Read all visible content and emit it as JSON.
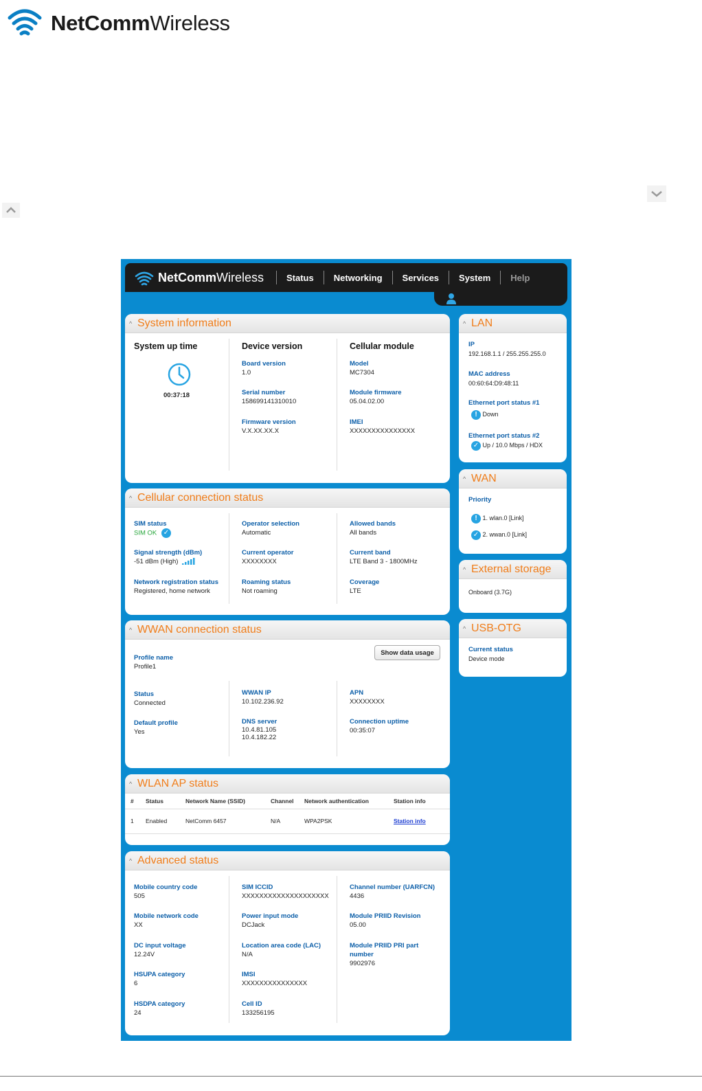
{
  "doc_logo": {
    "brand_bold": "NetComm",
    "brand_light": "Wireless"
  },
  "app": {
    "brand_bold": "NetComm",
    "brand_light": "Wireless",
    "nav": [
      "Status",
      "Networking",
      "Services",
      "System",
      "Help"
    ]
  },
  "system_info": {
    "title": "System information",
    "uptime_label": "System up time",
    "uptime": "00:37:18",
    "device_version": {
      "heading": "Device version",
      "fields": [
        {
          "label": "Board version",
          "value": "1.0"
        },
        {
          "label": "Serial number",
          "value": "158699141310010"
        },
        {
          "label": "Firmware version",
          "value": "V.X.XX.XX.X"
        }
      ]
    },
    "cellular_module": {
      "heading": "Cellular module",
      "fields": [
        {
          "label": "Model",
          "value": "MC7304"
        },
        {
          "label": "Module firmware",
          "value": "05.04.02.00"
        },
        {
          "label": "IMEI",
          "value": "XXXXXXXXXXXXXXX"
        }
      ]
    }
  },
  "cellular": {
    "title": "Cellular connection status",
    "sim_status_label": "SIM status",
    "sim_status": "SIM OK",
    "signal_label": "Signal strength (dBm)",
    "signal": "-51 dBm (High)",
    "netreg_label": "Network registration status",
    "netreg": "Registered, home network",
    "operator_selection_label": "Operator selection",
    "operator_selection": "Automatic",
    "current_operator_label": "Current operator",
    "current_operator": "XXXXXXXX",
    "roaming_label": "Roaming status",
    "roaming": "Not roaming",
    "allowed_bands_label": "Allowed bands",
    "allowed_bands": "All bands",
    "current_band_label": "Current band",
    "current_band": "LTE Band 3 - 1800MHz",
    "coverage_label": "Coverage",
    "coverage": "LTE"
  },
  "wwan": {
    "title": "WWAN connection status",
    "show_data_usage": "Show data usage",
    "profile_name_label": "Profile name",
    "profile_name": "Profile1",
    "status_label": "Status",
    "status": "Connected",
    "default_profile_label": "Default profile",
    "default_profile": "Yes",
    "wwan_ip_label": "WWAN IP",
    "wwan_ip": "10.102.236.92",
    "dns_label": "DNS server",
    "dns1": "10.4.81.105",
    "dns2": "10.4.182.22",
    "apn_label": "APN",
    "apn": "XXXXXXXX",
    "uptime_label": "Connection uptime",
    "uptime": "00:35:07"
  },
  "wlan": {
    "title": "WLAN AP status",
    "columns": [
      "#",
      "Status",
      "Network Name (SSID)",
      "Channel",
      "Network authentication",
      "Station info"
    ],
    "row": {
      "num": "1",
      "status": "Enabled",
      "ssid": "NetComm 6457",
      "channel": "N/A",
      "auth": "WPA2PSK",
      "station": "Station info"
    }
  },
  "advanced": {
    "title": "Advanced status",
    "col1": [
      {
        "label": "Mobile country code",
        "value": "505"
      },
      {
        "label": "Mobile network code",
        "value": "XX"
      },
      {
        "label": "DC input voltage",
        "value": "12.24V"
      },
      {
        "label": "HSUPA category",
        "value": "6"
      },
      {
        "label": "HSDPA category",
        "value": "24"
      }
    ],
    "col2": [
      {
        "label": "SIM ICCID",
        "value": "XXXXXXXXXXXXXXXXXXXX"
      },
      {
        "label": "Power input mode",
        "value": "DCJack"
      },
      {
        "label": "Location area code (LAC)",
        "value": "N/A"
      },
      {
        "label": "IMSI",
        "value": "XXXXXXXXXXXXXXX"
      },
      {
        "label": "Cell ID",
        "value": "133256195"
      }
    ],
    "col3": [
      {
        "label": "Channel number (UARFCN)",
        "value": "4436"
      },
      {
        "label": "Module PRIID Revision",
        "value": "05.00"
      },
      {
        "label": "Module PRIID PRI part number",
        "value": "9902976"
      }
    ]
  },
  "lan": {
    "title": "LAN",
    "ip_label": "IP",
    "ip": "192.168.1.1 / 255.255.255.0",
    "mac_label": "MAC address",
    "mac": "00:60:64:D9:48:11",
    "port1_label": "Ethernet port status #1",
    "port1": "Down",
    "port2_label": "Ethernet port status #2",
    "port2": "Up / 10.0 Mbps / HDX"
  },
  "wan": {
    "title": "WAN",
    "priority_label": "Priority",
    "item1": "1. wlan.0 [Link]",
    "item2": "2. wwan.0 [Link]"
  },
  "storage": {
    "title": "External storage",
    "value": "Onboard (3.7G)"
  },
  "usb": {
    "title": "USB-OTG",
    "label": "Current status",
    "value": "Device mode"
  },
  "colors": {
    "accent": "#f07d1a",
    "label_blue": "#0b5ea8",
    "frame_blue": "#0a8bd0",
    "badge_blue": "#27a4e2"
  }
}
